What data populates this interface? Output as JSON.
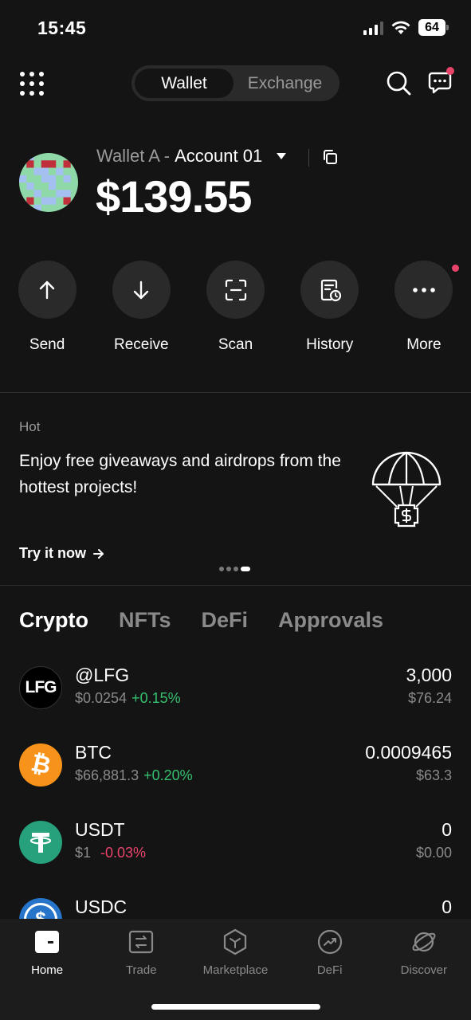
{
  "status_bar": {
    "time": "15:45",
    "battery": "64"
  },
  "header": {
    "segments": [
      {
        "label": "Wallet",
        "active": true
      },
      {
        "label": "Exchange",
        "active": false
      }
    ],
    "icons": [
      "grid-menu-icon",
      "search-icon",
      "chat-icon"
    ]
  },
  "wallet": {
    "name": "Wallet A -",
    "account": "Account 01",
    "balance": "$139.55"
  },
  "actions": [
    {
      "label": "Send",
      "icon": "arrow-up-icon"
    },
    {
      "label": "Receive",
      "icon": "arrow-down-icon"
    },
    {
      "label": "Scan",
      "icon": "scan-icon"
    },
    {
      "label": "History",
      "icon": "history-icon"
    },
    {
      "label": "More",
      "icon": "more-icon"
    }
  ],
  "hot": {
    "label": "Hot",
    "text": "Enjoy free giveaways and airdrops from the hottest projects!",
    "cta": "Try it now",
    "carousel_pages": 4,
    "carousel_active": 4
  },
  "tabs": [
    {
      "label": "Crypto",
      "active": true
    },
    {
      "label": "NFTs",
      "active": false
    },
    {
      "label": "DeFi",
      "active": false
    },
    {
      "label": "Approvals",
      "active": false
    }
  ],
  "tokens": [
    {
      "symbol": "@LFG",
      "price": "$0.0254",
      "change": "+0.15%",
      "direction": "up",
      "amount": "3,000",
      "value": "$76.24",
      "icon_text": "LFG",
      "icon_color": "#000000"
    },
    {
      "symbol": "BTC",
      "price": "$66,881.3",
      "change": "+0.20%",
      "direction": "up",
      "amount": "0.0009465",
      "value": "$63.3",
      "icon_text": "₿",
      "icon_color": "#f7931a"
    },
    {
      "symbol": "USDT",
      "price": "$1",
      "change": "-0.03%",
      "direction": "down",
      "amount": "0",
      "value": "$0.00",
      "icon_text": "T",
      "icon_color": "#26a17b"
    },
    {
      "symbol": "USDC",
      "price": "",
      "change": "",
      "direction": "",
      "amount": "0",
      "value": "",
      "icon_text": "$",
      "icon_color": "#2775ca"
    }
  ],
  "bottom_nav": [
    {
      "label": "Home",
      "active": true,
      "icon": "home-icon"
    },
    {
      "label": "Trade",
      "active": false,
      "icon": "trade-icon"
    },
    {
      "label": "Marketplace",
      "active": false,
      "icon": "marketplace-icon"
    },
    {
      "label": "DeFi",
      "active": false,
      "icon": "defi-icon"
    },
    {
      "label": "Discover",
      "active": false,
      "icon": "discover-icon"
    }
  ],
  "colors": {
    "background": "#141414",
    "positive": "#35c06f",
    "negative": "#e8446a",
    "muted": "#8a8a8a"
  }
}
